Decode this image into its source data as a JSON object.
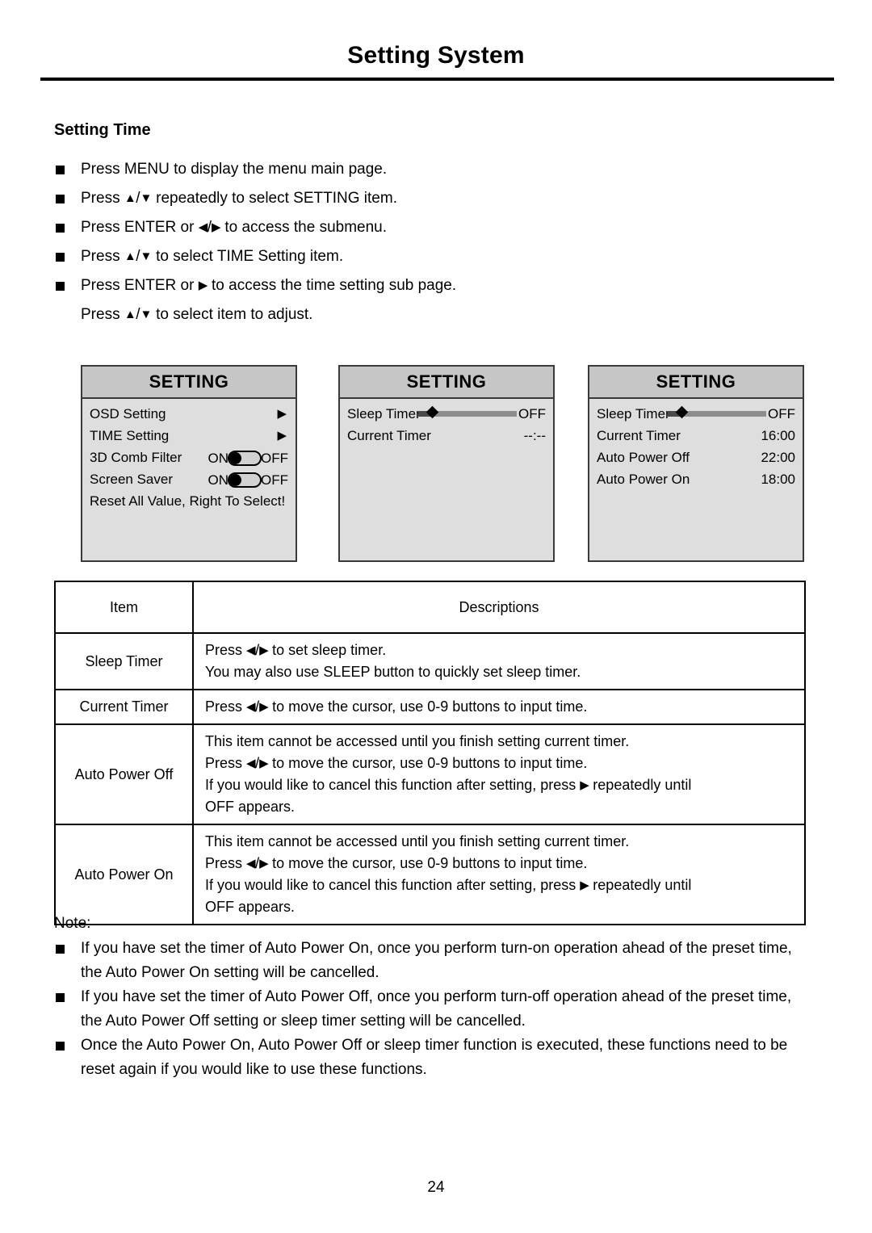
{
  "page": {
    "title": "Setting System",
    "number": "24",
    "section_heading": "Setting Time"
  },
  "steps": [
    {
      "bullet": true,
      "text": "Press MENU to display the menu main page."
    },
    {
      "bullet": true,
      "text": "Press ▲/▼ repeatedly to select SETTING item."
    },
    {
      "bullet": true,
      "text": "Press ENTER or ◀/▶ to access the submenu."
    },
    {
      "bullet": true,
      "text": "Press ▲/▼ to select TIME Setting item."
    },
    {
      "bullet": true,
      "text": "Press ENTER or ▶ to access the time setting sub page."
    },
    {
      "bullet": false,
      "text": "Press ▲/▼ to select item to adjust."
    }
  ],
  "osd_screens": [
    {
      "title": "SETTING",
      "rows": [
        {
          "label": "OSD Setting",
          "control": "arrow",
          "value": "▶"
        },
        {
          "label": "TIME Setting",
          "control": "arrow",
          "value": "▶"
        },
        {
          "label": "3D Comb Filter",
          "control": "toggle",
          "on_label": "ON",
          "off_label": "OFF",
          "state": "ON"
        },
        {
          "label": "Screen Saver",
          "control": "toggle",
          "on_label": "ON",
          "off_label": "OFF",
          "state": "ON"
        },
        {
          "label": "Reset All Value, Right To Select!",
          "control": "full"
        }
      ]
    },
    {
      "title": "SETTING",
      "rows": [
        {
          "label": "Sleep Timer",
          "control": "slider",
          "value": "OFF"
        },
        {
          "label": "Current Timer",
          "control": "text",
          "value": "--:--"
        }
      ]
    },
    {
      "title": "SETTING",
      "rows": [
        {
          "label": "Sleep Timer",
          "control": "slider",
          "value": "OFF"
        },
        {
          "label": "Current Timer",
          "control": "text",
          "value": "16:00"
        },
        {
          "label": "Auto Power Off",
          "control": "text",
          "value": "22:00"
        },
        {
          "label": "Auto Power On",
          "control": "text",
          "value": "18:00"
        }
      ]
    }
  ],
  "table": {
    "headers": {
      "item": "Item",
      "descriptions": "Descriptions"
    },
    "rows": [
      {
        "item": "Sleep Timer",
        "lines": [
          "Press ◀/▶ to set sleep timer.",
          "You may also use SLEEP button to quickly set sleep timer."
        ]
      },
      {
        "item": "Current Timer",
        "lines": [
          "Press ◀/▶ to move the cursor, use 0-9 buttons to input time."
        ]
      },
      {
        "item": "Auto Power Off",
        "lines": [
          "This item cannot be accessed until you finish setting current timer.",
          "Press ◀/▶  to move the cursor, use 0-9 buttons to input time.",
          "If you would like to cancel this function after setting, press ▶ repeatedly until",
          "OFF appears."
        ]
      },
      {
        "item": "Auto Power On",
        "lines": [
          "This item cannot be accessed until you finish setting current timer.",
          "Press ◀/▶ to move the cursor, use 0-9 buttons to input time.",
          "If you would like to cancel this function after setting, press ▶ repeatedly until",
          "OFF appears."
        ]
      }
    ]
  },
  "notes": {
    "label": "Note:",
    "items": [
      "If you have set the timer of Auto Power On, once you perform turn-on operation ahead of the preset time, the Auto Power On setting will be cancelled.",
      "If you have set the timer of Auto Power Off, once you perform turn-off operation ahead of the preset time, the Auto Power Off setting or sleep timer setting will be cancelled.",
      "Once the Auto Power On, Auto Power Off or sleep timer function is executed, these functions need to be reset again if you would like to use these functions."
    ]
  }
}
